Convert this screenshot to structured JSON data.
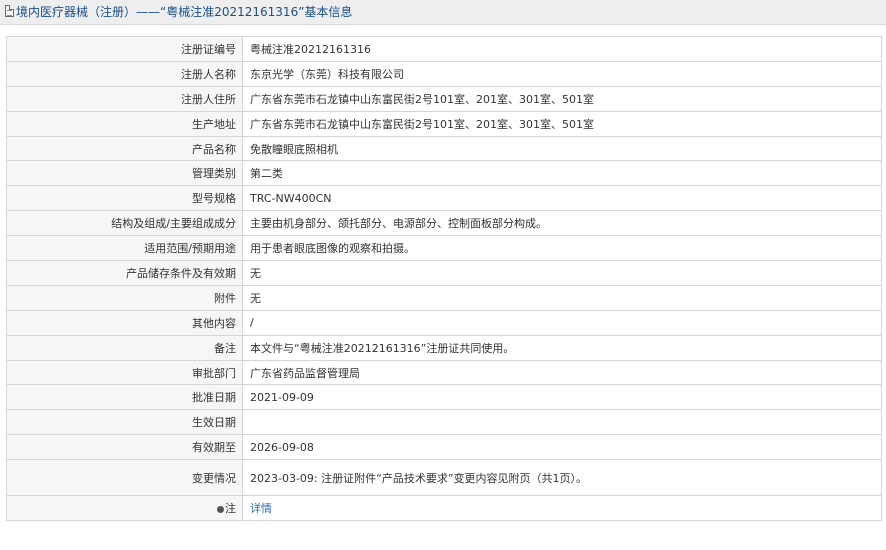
{
  "header": {
    "title": "境内医疗器械（注册）——“粤械注准20212161316”基本信息"
  },
  "rows": [
    {
      "label": "注册证编号",
      "value": "粤械注准20212161316"
    },
    {
      "label": "注册人名称",
      "value": "东京光学（东莞）科技有限公司"
    },
    {
      "label": "注册人住所",
      "value": "广东省东莞市石龙镇中山东富民街2号101室、201室、301室、501室"
    },
    {
      "label": "生产地址",
      "value": "广东省东莞市石龙镇中山东富民街2号101室、201室、301室、501室"
    },
    {
      "label": "产品名称",
      "value": "免散瞳眼底照相机"
    },
    {
      "label": "管理类别",
      "value": "第二类"
    },
    {
      "label": "型号规格",
      "value": "TRC-NW400CN"
    },
    {
      "label": "结构及组成/主要组成成分",
      "value": "主要由机身部分、颌托部分、电源部分、控制面板部分构成。"
    },
    {
      "label": "适用范围/预期用途",
      "value": "用于患者眼底图像的观察和拍摄。"
    },
    {
      "label": "产品储存条件及有效期",
      "value": "无"
    },
    {
      "label": "附件",
      "value": "无"
    },
    {
      "label": "其他内容",
      "value": "/"
    },
    {
      "label": "备注",
      "value": "本文件与“粤械注准20212161316”注册证共同使用。"
    },
    {
      "label": "审批部门",
      "value": "广东省药品监督管理局"
    },
    {
      "label": "批准日期",
      "value": "2021-09-09"
    },
    {
      "label": "生效日期",
      "value": ""
    },
    {
      "label": "有效期至",
      "value": "2026-09-08"
    },
    {
      "label": "变更情况",
      "value": "2023-03-09: 注册证附件“产品技术要求”变更内容见附页（共1页）。"
    }
  ],
  "note": {
    "label": "注",
    "link": "详情",
    "icon": "pin-icon"
  },
  "colors": {
    "title": "#1a4f8b",
    "link": "#2a6bc4",
    "label_bg": "#f6f6f6",
    "border": "#d6d6d6"
  }
}
